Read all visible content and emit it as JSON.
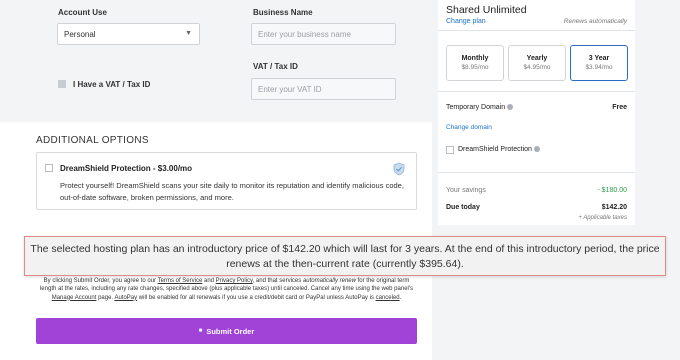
{
  "form": {
    "account_use_label": "Account Use",
    "account_use_value": "Personal",
    "business_name_label": "Business Name",
    "business_name_placeholder": "Enter your business name",
    "vat_checkbox_label": "I Have a VAT / Tax ID",
    "vat_label": "VAT / Tax ID",
    "vat_placeholder": "Enter your VAT ID"
  },
  "additional_options": {
    "title": "ADDITIONAL OPTIONS",
    "dreamshield": {
      "title": "DreamShield Protection - $3.00/mo",
      "description": "Protect yourself! DreamShield scans your site daily to monitor its reputation and identify malicious code, out-of-date software, broken permissions, and more."
    }
  },
  "caption": "The selected hosting plan has an introductory price of $142.20 which will last for 3 years. At the end of this introductory period, the price renews at the then-current rate (currently $395.64).",
  "legal": {
    "part1": "By clicking Submit Order, you agree to our ",
    "terms": "Terms of Service",
    "and": " and ",
    "privacy": "Privacy Policy",
    "part2": ", and that services ",
    "auto_renew": "automatically renew",
    "part3": " for the original term length at the rates, including any rate changes, specified above (plus applicable taxes) until canceled. Cancel any time using the web panel's ",
    "manage": "Manage Account",
    "part4": " page. ",
    "autopay": "AutoPay",
    "part5": " will be enabled for all renewals if you use a credit/debit card or PayPal unless AutoPay is ",
    "canceled": "canceled",
    "part6": "."
  },
  "submit_label": "Submit Order",
  "summary": {
    "plan_name": "Shared Unlimited",
    "change_plan": "Change plan",
    "renews": "Renews automatically",
    "terms": [
      {
        "name": "Monthly",
        "price": "$8.95/mo",
        "selected": false
      },
      {
        "name": "Yearly",
        "price": "$4.95/mo",
        "selected": false
      },
      {
        "name": "3 Year",
        "price": "$3.94/mo",
        "selected": true
      }
    ],
    "temp_domain_label": "Temporary Domain",
    "temp_domain_value": "Free",
    "change_domain": "Change domain",
    "dreamshield_label": "DreamShield Protection",
    "savings_label": "Your savings",
    "savings_value": "- $180.00",
    "due_label": "Due today",
    "due_value": "$142.20",
    "taxes_note": "+ Applicable taxes"
  },
  "colors": {
    "accent_purple": "#a043d6",
    "link_blue": "#1a73c9",
    "savings_green": "#2e9b47",
    "selected_border": "#2b6cc4"
  },
  "icons": [
    "chevron-down-icon",
    "shield-icon",
    "info-icon",
    "lock-icon"
  ]
}
